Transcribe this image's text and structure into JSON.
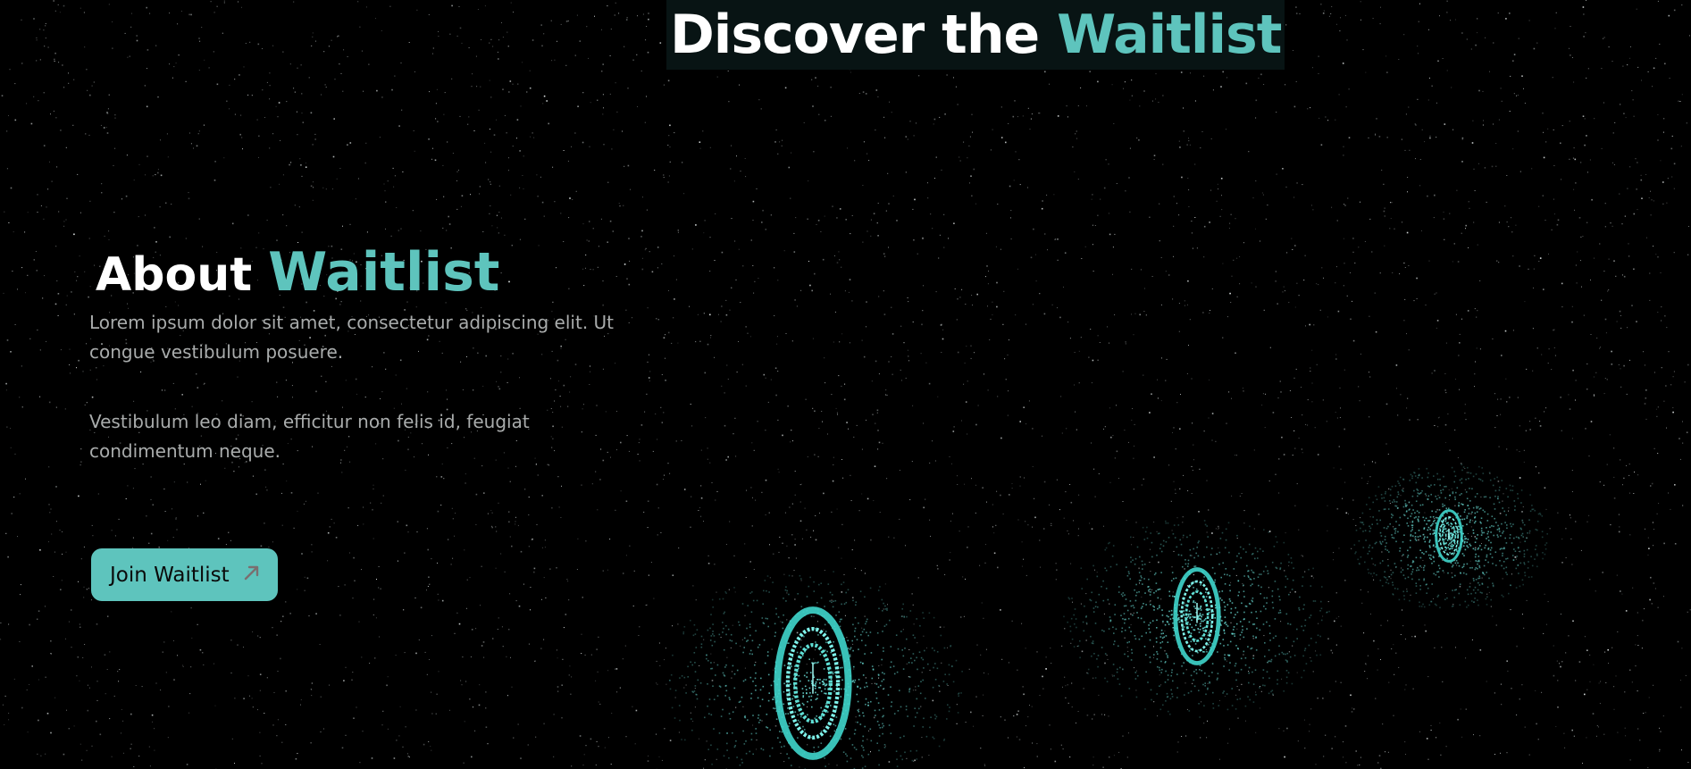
{
  "hero": {
    "title_prefix": "Discover the ",
    "title_accent": "Waitlist"
  },
  "about": {
    "heading_prefix": "About ",
    "heading_accent": "Waitlist",
    "paragraphs": [
      "Lorem ipsum dolor sit amet, consectetur adipiscing elit. Ut congue vestibulum posuere.",
      "Vestibulum leo diam, efficitur non felis id, feugiat condimentum neque."
    ],
    "cta_label": "Join Waitlist",
    "cta_icon": "arrow-up-right-icon"
  },
  "theme": {
    "background": "#000000",
    "accent": "#5ec4bd",
    "particle": "#6fe8e0"
  }
}
